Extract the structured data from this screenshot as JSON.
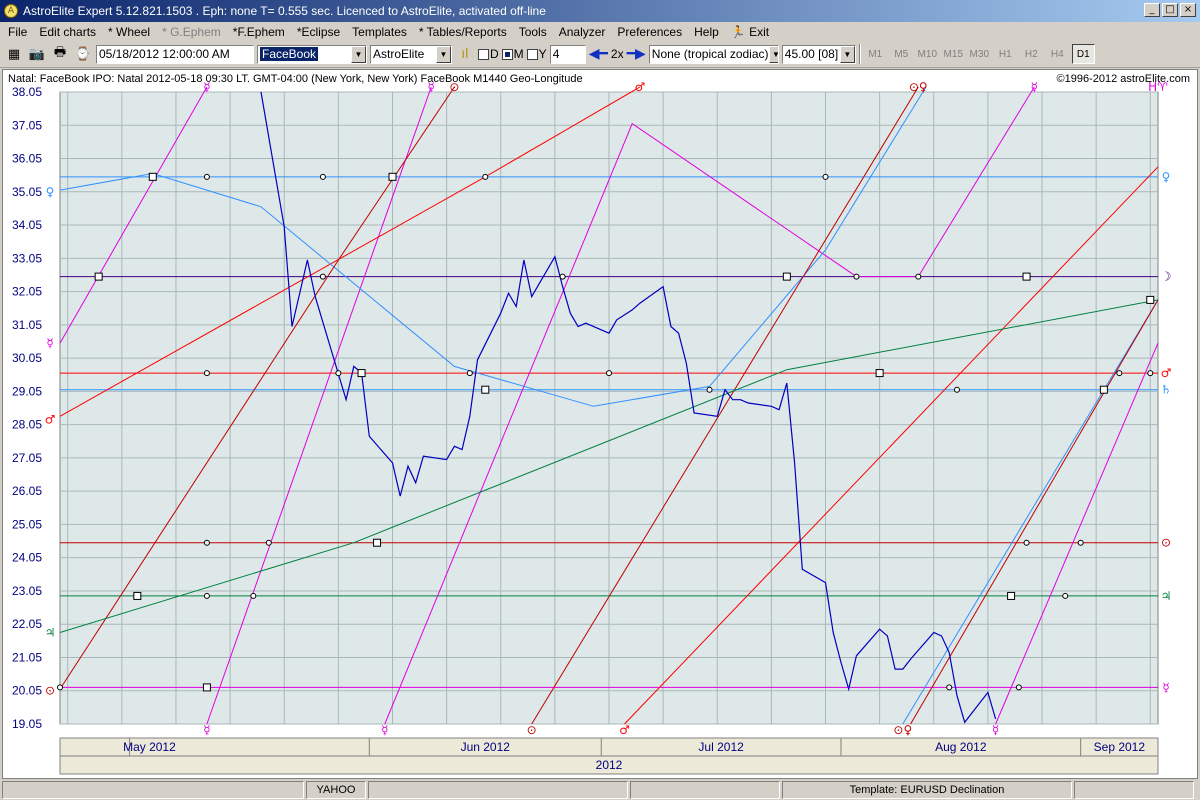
{
  "window": {
    "title": "AstroElite Expert 5.12.821.1503 . Eph: none T= 0.555 sec. Licenced to AstroElite, activated off-line",
    "minimize": "_",
    "maximize": "□",
    "close": "×"
  },
  "menu": [
    {
      "label": "File",
      "disabled": false
    },
    {
      "label": "Edit charts",
      "disabled": false
    },
    {
      "label": "* Wheel",
      "disabled": false
    },
    {
      "label": "* G.Ephem",
      "disabled": true
    },
    {
      "label": "*F.Ephem",
      "disabled": false
    },
    {
      "label": "*Eclipse",
      "disabled": false
    },
    {
      "label": "Templates",
      "disabled": false
    },
    {
      "label": "* Tables/Reports",
      "disabled": false
    },
    {
      "label": "Tools",
      "disabled": false
    },
    {
      "label": "Analyzer",
      "disabled": false
    },
    {
      "label": "Preferences",
      "disabled": false
    },
    {
      "label": "Help",
      "disabled": false
    },
    {
      "label": "Exit",
      "disabled": false
    }
  ],
  "toolbar": {
    "date_value": "05/18/2012  12:00:00 AM",
    "chart_select": "FaceBook",
    "source_select": "AstroElite",
    "period_d": "D",
    "period_m": "M",
    "period_y": "Y",
    "step_value": "4",
    "zoom_label": "2x",
    "zodiac_select": "None (tropical zodiac)",
    "angle_select": "45.00 [08]",
    "timeframes": [
      "M1",
      "M5",
      "M10",
      "M15",
      "M30",
      "H1",
      "H2",
      "H4",
      "D1"
    ],
    "active_timeframe": "D1"
  },
  "info": {
    "natal_line": "Natal: FaceBook IPO: Natal 2012-05-18 09:30 LT. GMT-04:00 (New York, New York) FaceBook M1440 Geo-Longitude",
    "copyright": "©1996-2012 astroElite.com"
  },
  "colors": {
    "price": "#0000c0",
    "venus": "#3090ff",
    "mercury": "#e000e0",
    "mars": "#ff0000",
    "jupiter": "#008040",
    "saturn": "#3090ff",
    "sun": "#c00000",
    "moon": "#400080",
    "grid": "#a8b8b8",
    "plot_bg": "#dfe8e8"
  },
  "chart_data": {
    "type": "line",
    "ylim": [
      19.05,
      38.05
    ],
    "yticks": [
      "38.05",
      "37.05",
      "36.05",
      "35.05",
      "34.05",
      "33.05",
      "32.05",
      "31.05",
      "30.05",
      "29.05",
      "28.05",
      "27.05",
      "26.05",
      "25.05",
      "24.05",
      "23.05",
      "22.05",
      "21.05",
      "20.05",
      "19.05"
    ],
    "x_start": "2012-04-22",
    "x_end": "2012-09-11",
    "month_labels": [
      "May 2012",
      "Jun 2012",
      "Jul 2012",
      "Aug 2012",
      "Sep 2012"
    ],
    "year_label": "2012",
    "price_series": {
      "name": "FaceBook",
      "points": [
        [
          "2012-05-18",
          38.2
        ],
        [
          "2012-05-21",
          34.0
        ],
        [
          "2012-05-22",
          31.0
        ],
        [
          "2012-05-23",
          32.0
        ],
        [
          "2012-05-24",
          33.0
        ],
        [
          "2012-05-25",
          31.9
        ],
        [
          "2012-05-29",
          28.8
        ],
        [
          "2012-05-30",
          29.8
        ],
        [
          "2012-05-31",
          29.6
        ],
        [
          "2012-06-01",
          27.7
        ],
        [
          "2012-06-04",
          26.9
        ],
        [
          "2012-06-05",
          25.9
        ],
        [
          "2012-06-06",
          26.8
        ],
        [
          "2012-06-07",
          26.3
        ],
        [
          "2012-06-08",
          27.1
        ],
        [
          "2012-06-11",
          27.0
        ],
        [
          "2012-06-12",
          27.4
        ],
        [
          "2012-06-13",
          27.3
        ],
        [
          "2012-06-14",
          28.3
        ],
        [
          "2012-06-15",
          30.0
        ],
        [
          "2012-06-18",
          31.4
        ],
        [
          "2012-06-19",
          32.0
        ],
        [
          "2012-06-20",
          31.6
        ],
        [
          "2012-06-21",
          33.0
        ],
        [
          "2012-06-22",
          31.9
        ],
        [
          "2012-06-25",
          33.1
        ],
        [
          "2012-06-26",
          32.2
        ],
        [
          "2012-06-27",
          31.4
        ],
        [
          "2012-06-28",
          31.0
        ],
        [
          "2012-06-29",
          31.1
        ],
        [
          "2012-07-02",
          30.8
        ],
        [
          "2012-07-03",
          31.2
        ],
        [
          "2012-07-05",
          31.5
        ],
        [
          "2012-07-06",
          31.7
        ],
        [
          "2012-07-09",
          32.2
        ],
        [
          "2012-07-10",
          31.0
        ],
        [
          "2012-07-11",
          30.8
        ],
        [
          "2012-07-12",
          29.9
        ],
        [
          "2012-07-13",
          28.4
        ],
        [
          "2012-07-16",
          28.3
        ],
        [
          "2012-07-17",
          29.1
        ],
        [
          "2012-07-18",
          28.8
        ],
        [
          "2012-07-19",
          28.8
        ],
        [
          "2012-07-20",
          28.7
        ],
        [
          "2012-07-23",
          28.6
        ],
        [
          "2012-07-24",
          28.5
        ],
        [
          "2012-07-25",
          29.3
        ],
        [
          "2012-07-26",
          26.9
        ],
        [
          "2012-07-27",
          23.7
        ],
        [
          "2012-07-30",
          23.3
        ],
        [
          "2012-07-31",
          21.8
        ],
        [
          "2012-08-01",
          20.9
        ],
        [
          "2012-08-02",
          20.1
        ],
        [
          "2012-08-03",
          21.1
        ],
        [
          "2012-08-06",
          21.9
        ],
        [
          "2012-08-07",
          21.7
        ],
        [
          "2012-08-08",
          20.7
        ],
        [
          "2012-08-09",
          20.7
        ],
        [
          "2012-08-10",
          21.0
        ],
        [
          "2012-08-13",
          21.8
        ],
        [
          "2012-08-14",
          21.7
        ],
        [
          "2012-08-15",
          21.2
        ],
        [
          "2012-08-16",
          19.9
        ],
        [
          "2012-08-17",
          19.1
        ],
        [
          "2012-08-20",
          20.0
        ],
        [
          "2012-08-21",
          19.2
        ]
      ]
    },
    "horizontal_lines": [
      {
        "planet": "venus",
        "glyph": "♀",
        "value": 35.5
      },
      {
        "planet": "moon",
        "glyph": "☽",
        "value": 32.5
      },
      {
        "planet": "mars",
        "glyph": "♂",
        "value": 29.6
      },
      {
        "planet": "saturn",
        "glyph": "♄",
        "value": 29.1
      },
      {
        "planet": "sun",
        "glyph": "⊙",
        "value": 24.5
      },
      {
        "planet": "jupiter",
        "glyph": "♃",
        "value": 22.9
      },
      {
        "planet": "mercury",
        "glyph": "☿",
        "value": 20.15
      }
    ],
    "planetary_lines": [
      {
        "planet": "mercury",
        "color": "#e000e0",
        "points": [
          [
            "2012-04-22",
            30.5
          ],
          [
            "2012-05-11",
            38.2
          ]
        ]
      },
      {
        "planet": "mercury",
        "color": "#e000e0",
        "points": [
          [
            "2012-05-11",
            19.05
          ],
          [
            "2012-06-09",
            38.2
          ]
        ]
      },
      {
        "planet": "mercury",
        "color": "#e000e0",
        "points": [
          [
            "2012-06-03",
            19.05
          ],
          [
            "2012-07-05",
            37.1
          ],
          [
            "2012-08-03",
            32.5
          ],
          [
            "2012-08-11",
            32.5
          ],
          [
            "2012-08-26",
            38.2
          ]
        ]
      },
      {
        "planet": "mercury",
        "color": "#e000e0",
        "points": [
          [
            "2012-08-21",
            19.05
          ],
          [
            "2012-09-11",
            30.5
          ]
        ]
      },
      {
        "planet": "mars",
        "color": "#ff0000",
        "points": [
          [
            "2012-04-22",
            28.3
          ],
          [
            "2012-06-16",
            35.5
          ],
          [
            "2012-07-06",
            38.2
          ]
        ]
      },
      {
        "planet": "mars",
        "color": "#ff0000",
        "points": [
          [
            "2012-07-04",
            19.05
          ],
          [
            "2012-09-11",
            35.8
          ]
        ]
      },
      {
        "planet": "venus",
        "color": "#3090ff",
        "points": [
          [
            "2012-04-22",
            35.1
          ],
          [
            "2012-05-04",
            35.6
          ],
          [
            "2012-05-18",
            34.6
          ],
          [
            "2012-06-12",
            29.8
          ],
          [
            "2012-06-30",
            28.6
          ],
          [
            "2012-07-15",
            29.2
          ],
          [
            "2012-07-30",
            33.3
          ],
          [
            "2012-08-12",
            38.2
          ]
        ]
      },
      {
        "planet": "venus",
        "color": "#3090ff",
        "points": [
          [
            "2012-08-09",
            19.05
          ],
          [
            "2012-09-11",
            31.8
          ]
        ]
      },
      {
        "planet": "sun",
        "color": "#c00000",
        "points": [
          [
            "2012-04-22",
            20.1
          ],
          [
            "2012-05-28",
            33.0
          ],
          [
            "2012-06-12",
            38.2
          ]
        ]
      },
      {
        "planet": "sun",
        "color": "#c00000",
        "points": [
          [
            "2012-06-22",
            19.05
          ],
          [
            "2012-08-11",
            38.2
          ]
        ]
      },
      {
        "planet": "sun",
        "color": "#c00000",
        "points": [
          [
            "2012-08-10",
            19.05
          ],
          [
            "2012-09-11",
            31.8
          ]
        ]
      },
      {
        "planet": "jupiter",
        "color": "#008040",
        "points": [
          [
            "2012-04-22",
            21.8
          ],
          [
            "2012-05-30",
            24.5
          ],
          [
            "2012-07-25",
            29.7
          ],
          [
            "2012-09-11",
            31.8
          ]
        ]
      }
    ],
    "top_glyphs": [
      {
        "glyph": "☿",
        "planet": "mercury",
        "date": "2012-05-11"
      },
      {
        "glyph": "☿",
        "planet": "mercury",
        "date": "2012-06-09"
      },
      {
        "glyph": "⊙",
        "planet": "sun",
        "date": "2012-06-12"
      },
      {
        "glyph": "♂",
        "planet": "mars",
        "date": "2012-07-06"
      },
      {
        "glyph": "⊙♀",
        "planet": "sun",
        "date": "2012-08-11"
      },
      {
        "glyph": "☿",
        "planet": "mercury",
        "date": "2012-08-26"
      },
      {
        "glyph": "H♈",
        "planet": "mercury",
        "date": "2012-09-11"
      }
    ],
    "bottom_glyphs": [
      {
        "glyph": "☿",
        "planet": "mercury",
        "date": "2012-05-11"
      },
      {
        "glyph": "☿",
        "planet": "mercury",
        "date": "2012-06-03"
      },
      {
        "glyph": "⊙",
        "planet": "sun",
        "date": "2012-06-22"
      },
      {
        "glyph": "♂",
        "planet": "mars",
        "date": "2012-07-04"
      },
      {
        "glyph": "⊙♀",
        "planet": "sun",
        "date": "2012-08-09"
      },
      {
        "glyph": "☿",
        "planet": "mercury",
        "date": "2012-08-21"
      }
    ],
    "left_glyphs": [
      {
        "glyph": "♀",
        "planet": "venus",
        "value": 35.05
      },
      {
        "glyph": "☿",
        "planet": "mercury",
        "value": 30.5
      },
      {
        "glyph": "♂",
        "planet": "mars",
        "value": 28.2
      },
      {
        "glyph": "♃",
        "planet": "jupiter",
        "value": 21.8
      },
      {
        "glyph": "⊙",
        "planet": "sun",
        "value": 20.05
      }
    ],
    "right_glyphs": [
      {
        "glyph": "♀",
        "planet": "venus",
        "value": 35.5
      },
      {
        "glyph": "☽",
        "planet": "moon",
        "value": 32.5
      },
      {
        "glyph": "♂",
        "planet": "mars",
        "value": 29.6
      },
      {
        "glyph": "♄",
        "planet": "saturn",
        "value": 29.1
      },
      {
        "glyph": "⊙",
        "planet": "sun",
        "value": 24.5
      },
      {
        "glyph": "♃",
        "planet": "jupiter",
        "value": 22.9
      },
      {
        "glyph": "☿",
        "planet": "mercury",
        "value": 20.15
      }
    ],
    "intersections": [
      {
        "date": "2012-05-04",
        "value": 35.5
      },
      {
        "date": "2012-05-11",
        "value": 35.5
      },
      {
        "date": "2012-05-26",
        "value": 35.5
      },
      {
        "date": "2012-06-04",
        "value": 35.5
      },
      {
        "date": "2012-06-16",
        "value": 35.5
      },
      {
        "date": "2012-07-30",
        "value": 35.5
      },
      {
        "date": "2012-04-27",
        "value": 32.5
      },
      {
        "date": "2012-05-26",
        "value": 32.5
      },
      {
        "date": "2012-06-26",
        "value": 32.5
      },
      {
        "date": "2012-07-25",
        "value": 32.5
      },
      {
        "date": "2012-08-03",
        "value": 32.5
      },
      {
        "date": "2012-08-11",
        "value": 32.5
      },
      {
        "date": "2012-08-25",
        "value": 32.5
      },
      {
        "date": "2012-05-11",
        "value": 29.6
      },
      {
        "date": "2012-05-28",
        "value": 29.6
      },
      {
        "date": "2012-05-31",
        "value": 29.6
      },
      {
        "date": "2012-06-14",
        "value": 29.6
      },
      {
        "date": "2012-07-02",
        "value": 29.6
      },
      {
        "date": "2012-08-06",
        "value": 29.6
      },
      {
        "date": "2012-09-06",
        "value": 29.6
      },
      {
        "date": "2012-09-10",
        "value": 29.6
      },
      {
        "date": "2012-06-16",
        "value": 29.1
      },
      {
        "date": "2012-07-15",
        "value": 29.1
      },
      {
        "date": "2012-08-16",
        "value": 29.1
      },
      {
        "date": "2012-09-04",
        "value": 29.1
      },
      {
        "date": "2012-05-11",
        "value": 24.5
      },
      {
        "date": "2012-05-19",
        "value": 24.5
      },
      {
        "date": "2012-06-02",
        "value": 24.5
      },
      {
        "date": "2012-08-25",
        "value": 24.5
      },
      {
        "date": "2012-09-01",
        "value": 24.5
      },
      {
        "date": "2012-05-02",
        "value": 22.9
      },
      {
        "date": "2012-05-11",
        "value": 22.9
      },
      {
        "date": "2012-05-17",
        "value": 22.9
      },
      {
        "date": "2012-08-23",
        "value": 22.9
      },
      {
        "date": "2012-08-30",
        "value": 22.9
      },
      {
        "date": "2012-04-22",
        "value": 20.15
      },
      {
        "date": "2012-05-11",
        "value": 20.15
      },
      {
        "date": "2012-08-15",
        "value": 20.15
      },
      {
        "date": "2012-08-24",
        "value": 20.15
      },
      {
        "date": "2012-09-10",
        "value": 31.8
      }
    ]
  },
  "status": {
    "panel1": "",
    "panel2": "YAHOO",
    "panel3": "",
    "panel4": "",
    "template": "Template: EURUSD Declination",
    "panel6": ""
  }
}
